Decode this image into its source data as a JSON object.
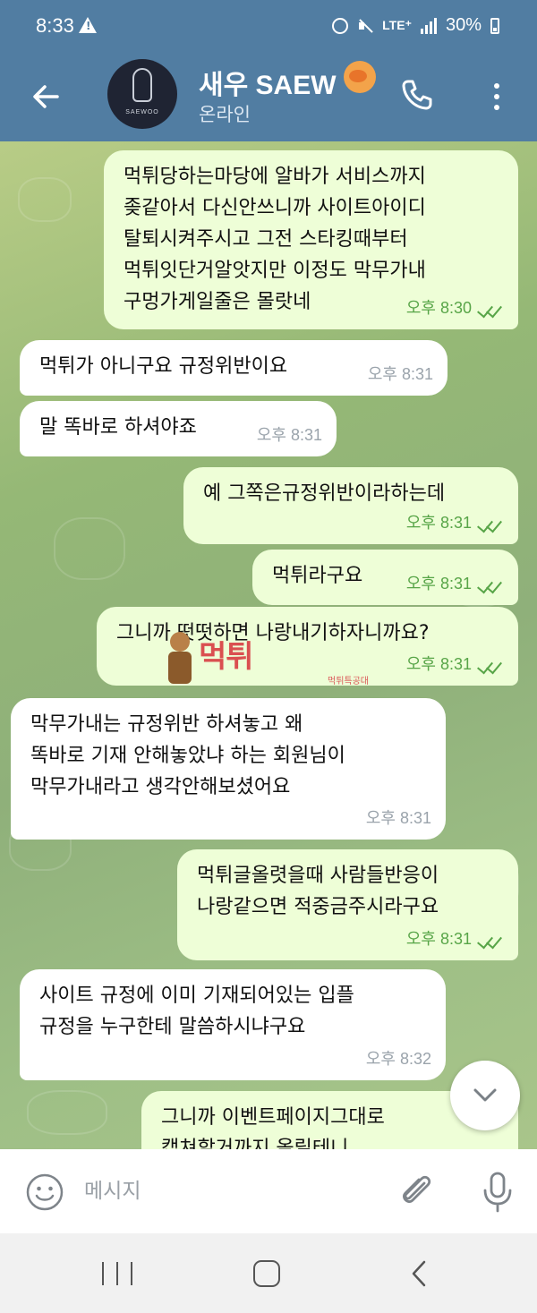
{
  "status_bar": {
    "time": "8:33",
    "network": "LTE⁺",
    "battery": "30%"
  },
  "header": {
    "title": "새우 SAEW",
    "status": "온라인",
    "avatar_text": "SAEWOO"
  },
  "messages": [
    {
      "direction": "out",
      "lines": [
        "먹튀당하는마당에 알바가 서비스까지",
        "좆같아서 다신안쓰니까 사이트아이디",
        "탈퇴시켜주시고 그전 스타킹때부터",
        "먹튀잇단거알앗지만 이정도 막무가내",
        "구멍가게일줄은 몰랏네"
      ],
      "time": "오후 8:30",
      "read": true
    },
    {
      "direction": "in",
      "lines": [
        "먹튀가 아니구요 규정위반이요"
      ],
      "time": "오후 8:31"
    },
    {
      "direction": "in",
      "lines": [
        "말 똑바로 하셔야죠"
      ],
      "time": "오후 8:31"
    },
    {
      "direction": "out",
      "lines": [
        "예 그쪽은규정위반이라하는데"
      ],
      "time": "오후 8:31",
      "read": true
    },
    {
      "direction": "out",
      "lines": [
        "먹튀라구요"
      ],
      "time": "오후 8:31",
      "read": true
    },
    {
      "direction": "out",
      "lines": [
        "그니까 떳떳하면 나랑내기하자니까요?"
      ],
      "time": "오후 8:31",
      "read": true
    },
    {
      "direction": "in",
      "lines": [
        "막무가내는 규정위반 하셔놓고 왜",
        "똑바로 기재 안해놓았냐 하는 회원님이",
        "막무가내라고 생각안해보셨어요"
      ],
      "time": "오후 8:31"
    },
    {
      "direction": "out",
      "lines": [
        "먹튀글올렷을때 사람들반응이",
        "나랑같으면 적중금주시라구요"
      ],
      "time": "오후 8:31",
      "read": true
    },
    {
      "direction": "in",
      "lines": [
        "사이트 규정에 이미 기재되어있는 입플",
        "규정을 누구한테 말씀하시냐구요"
      ],
      "time": "오후 8:32"
    },
    {
      "direction": "out",
      "lines": [
        "그니까 이벤트페이지그대로",
        "캡쳐할거까지 올릴테니"
      ],
      "time": ""
    }
  ],
  "watermark": {
    "main": "먹튀",
    "sub": "먹튀특공대"
  },
  "input": {
    "placeholder": "메시지"
  },
  "colors": {
    "header": "#517da2",
    "outgoing_bubble": "#eefed7",
    "incoming_bubble": "#ffffff",
    "read_check": "#58a548"
  }
}
